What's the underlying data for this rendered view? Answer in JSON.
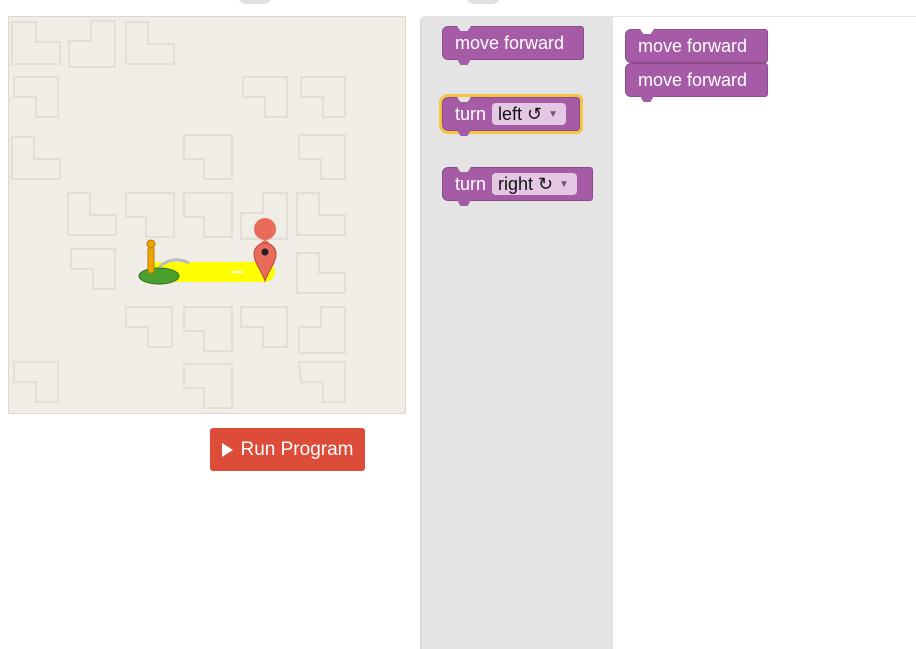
{
  "toolbox": {
    "move_forward": "move forward",
    "turn_left_prefix": "turn",
    "turn_left_value": "left ↺",
    "turn_right_prefix": "turn",
    "turn_right_value": "right ↻"
  },
  "workspace": {
    "blocks": [
      "move forward",
      "move forward"
    ]
  },
  "controls": {
    "run_label": "Run Program"
  },
  "colors": {
    "block": "#a55ba6",
    "run_button": "#dd4b39",
    "path": "#ffff00",
    "maze_bg": "#f0ede6"
  },
  "icons": [
    "play-icon",
    "pegman-start-icon",
    "goal-marker-icon",
    "dropdown-caret-icon"
  ]
}
